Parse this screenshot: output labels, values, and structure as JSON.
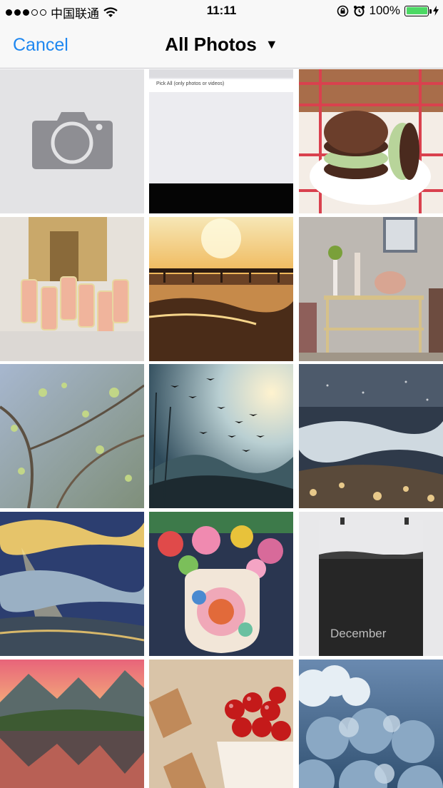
{
  "status_bar": {
    "carrier": "中国联通",
    "time": "11:11",
    "battery_percent": "100%",
    "battery_level": 1.0,
    "signal_dots_filled": 3,
    "signal_dots_total": 5,
    "icons": [
      "signal-dots",
      "wifi-icon",
      "rotation-lock-icon",
      "alarm-icon",
      "battery-icon",
      "charging-bolt-icon"
    ]
  },
  "nav": {
    "cancel_label": "Cancel",
    "title": "All Photos",
    "title_caret": "▼"
  },
  "grid": {
    "camera_tile": {
      "icon": "camera-icon"
    },
    "pick_all_tile": {
      "label": "Pick All (only photos or videos)"
    },
    "photos": [
      {
        "name": "photo-ice-cream-sandwich"
      },
      {
        "name": "photo-champagne-glasses"
      },
      {
        "name": "photo-pier-sunset"
      },
      {
        "name": "photo-living-room-shelf"
      },
      {
        "name": "photo-spring-branches"
      },
      {
        "name": "photo-birds-sunrise"
      },
      {
        "name": "photo-sparkling-water"
      },
      {
        "name": "photo-sky-rays-clouds"
      },
      {
        "name": "photo-floral-vase"
      },
      {
        "name": "photo-december-poster",
        "text": "December"
      },
      {
        "name": "photo-mountain-lake"
      },
      {
        "name": "photo-cherries-bowl"
      },
      {
        "name": "photo-blue-clouds"
      }
    ]
  }
}
